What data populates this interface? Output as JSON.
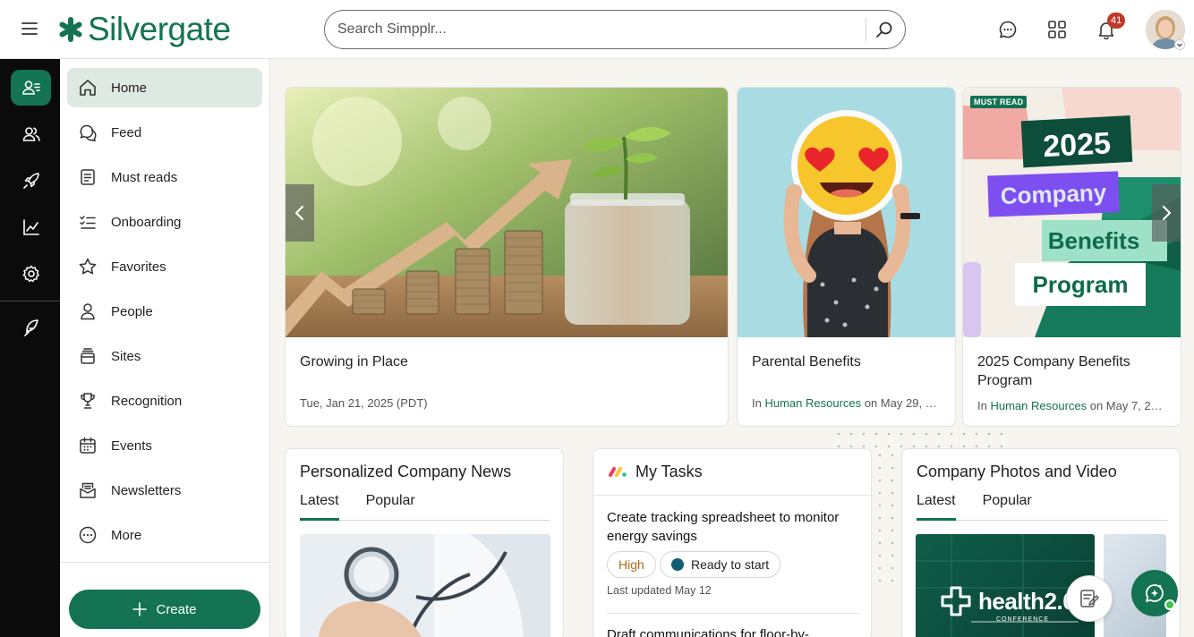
{
  "header": {
    "brand": "Silvergate",
    "search_placeholder": "Search Simpplr...",
    "notification_count": "41"
  },
  "rail": [
    "people-card-icon",
    "people-icon",
    "rocket-icon",
    "analytics-icon",
    "settings-icon",
    "feather-icon"
  ],
  "nav": {
    "items": [
      {
        "label": "Home",
        "icon": "home-icon"
      },
      {
        "label": "Feed",
        "icon": "feed-icon"
      },
      {
        "label": "Must reads",
        "icon": "must-reads-icon"
      },
      {
        "label": "Onboarding",
        "icon": "onboarding-icon"
      },
      {
        "label": "Favorites",
        "icon": "star-icon"
      },
      {
        "label": "People",
        "icon": "person-icon"
      },
      {
        "label": "Sites",
        "icon": "sites-icon"
      },
      {
        "label": "Recognition",
        "icon": "trophy-icon"
      },
      {
        "label": "Events",
        "icon": "calendar-icon"
      },
      {
        "label": "Newsletters",
        "icon": "newsletter-icon"
      },
      {
        "label": "More",
        "icon": "more-icon"
      }
    ],
    "create_label": "Create"
  },
  "carousel": [
    {
      "title": "Growing in Place",
      "date": "Tue, Jan 21, 2025 (PDT)"
    },
    {
      "title": "Parental Benefits",
      "meta_prefix": "In ",
      "site": "Human Resources",
      "meta_suffix": " on May 29, 2..."
    },
    {
      "title": "2025 Company Benefits Program",
      "badge": "MUST READ",
      "meta_prefix": "In ",
      "site": "Human Resources",
      "meta_suffix": " on May 7, 20...",
      "image_lines": [
        "2025",
        "Company",
        "Benefits",
        "Program"
      ]
    }
  ],
  "news": {
    "title": "Personalized Company News",
    "tabs": [
      "Latest",
      "Popular"
    ]
  },
  "tasks": {
    "title": "My Tasks",
    "items": [
      {
        "title": "Create tracking spreadsheet to monitor energy savings",
        "priority": "High",
        "status": "Ready to start",
        "updated": "Last updated May 12"
      },
      {
        "title": "Draft communications for floor-by-"
      }
    ]
  },
  "photos": {
    "title": "Company Photos and Video",
    "tabs": [
      "Latest",
      "Popular"
    ],
    "image_text": "health2.0",
    "image_subtext": "CONFERENCE"
  },
  "colors": {
    "brand_green": "#137353",
    "nav_active_bg": "#dde9e2",
    "badge_red": "#c0392b",
    "rail_bg": "#0b0b0b"
  }
}
